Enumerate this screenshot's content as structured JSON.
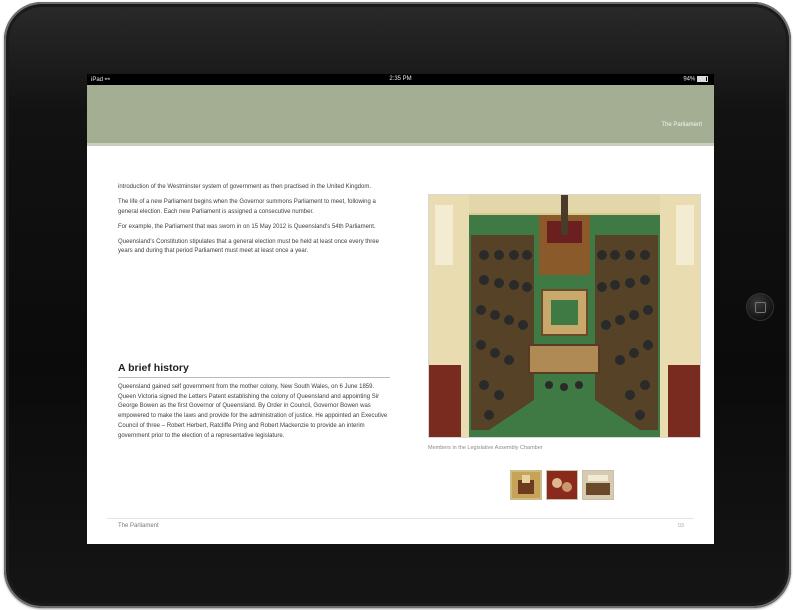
{
  "status_bar": {
    "device": "iPad",
    "wifi_icon": "wifi-icon",
    "time": "2:35 PM",
    "battery": "94%",
    "battery_icon": "battery-icon"
  },
  "header": {
    "title": "The Parliament",
    "color": "#a3ae93"
  },
  "intro_paragraphs": [
    "introduction of the Westminster system of government as then practised in the United Kingdom.",
    "The life of a new Parliament begins when the Governor summons Parliament to meet, following a general election. Each new Parliament is assigned a consecutive number.",
    "For example, the Parliament that was sworn in on 15 May 2012 is Queensland's 54th Parliament.",
    "Queensland's Constitution stipulates that a general election must be held at least once every three years and during that period Parliament must meet at least once a year."
  ],
  "history": {
    "heading": "A brief history",
    "text": "Queensland gained self government from the mother colony, New South Wales, on 6 June 1859. Queen Victoria signed the Letters Patent establishing the colony of Queensland and appointing Sir George Bowen as the first Governor of Queensland. By Order in Council, Governor Bowen was empowered to make the laws and provide for the administration of justice. He appointed an Executive Council of three – Robert Herbert, Ratcliffe Pring and Robert Mackenzie to provide an interim government prior to the election of a representative legislature."
  },
  "photo": {
    "caption": "Members in the Legislative Assembly Chamber"
  },
  "thumbnails": [
    {
      "name": "thumbnail-1",
      "active": true
    },
    {
      "name": "thumbnail-2",
      "active": false
    },
    {
      "name": "thumbnail-3",
      "active": false
    }
  ],
  "footer": {
    "title": "The Parliament",
    "page": "03"
  }
}
